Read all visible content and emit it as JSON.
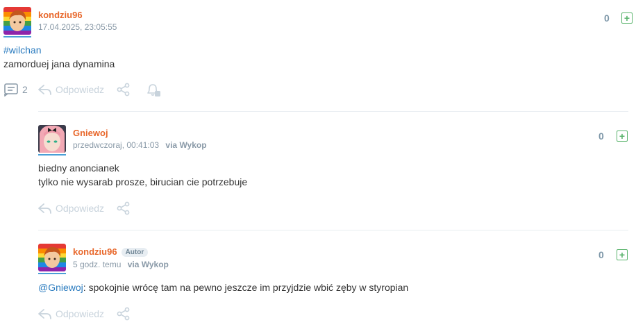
{
  "post": {
    "username": "kondziu96",
    "timestamp": "17.04.2025, 23:05:55",
    "votes": "0",
    "tag": "#wilchan",
    "text": "zamorduej jana dynamina",
    "comment_count": "2",
    "reply_label": "Odpowiedz",
    "icons": [
      "comments-icon",
      "reply-icon",
      "share-icon",
      "notify-bell-icon"
    ]
  },
  "comments": [
    {
      "username": "Gniewoj",
      "timestamp": "przedwczoraj, 00:41:03",
      "via": "via Wykop",
      "votes": "0",
      "lines": [
        "biedny anoncianek",
        "tylko nie wysarab prosze, birucian cie potrzebuje"
      ],
      "reply_label": "Odpowiedz"
    },
    {
      "username": "kondziu96",
      "badge": "Autor",
      "timestamp": "5 godz. temu",
      "via": "via Wykop",
      "votes": "0",
      "mention": "@Gniewoj",
      "text": ": spokojnie wrócę tam na pewno jeszcze im przyjdzie wbić zęby w styropian",
      "reply_label": "Odpowiedz"
    }
  ],
  "colors": {
    "username": "#e8672b",
    "link": "#2a7bbf",
    "plus": "#58b36b",
    "muted": "#c8d3dc"
  }
}
